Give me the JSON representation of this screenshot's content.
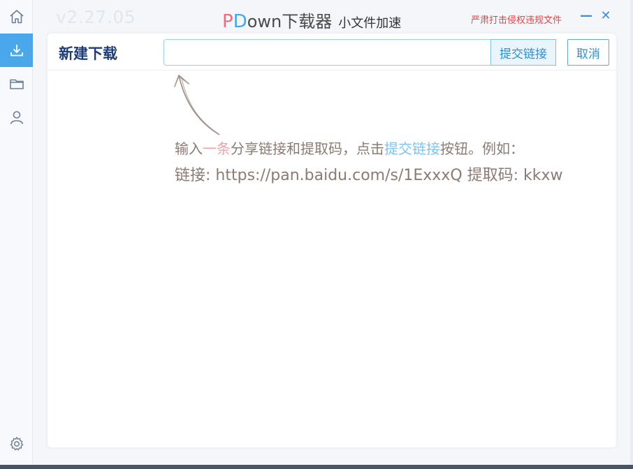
{
  "header": {
    "version": "v2.27.05",
    "brand": {
      "p": "P",
      "d": "D",
      "rest": "own下载器",
      "subtitle": "小文件加速"
    },
    "warning": "严肃打击侵权违规文件",
    "minimize_label": "—",
    "close_label": "✕"
  },
  "sidebar": {
    "items": [
      {
        "icon": "home-icon",
        "active": false
      },
      {
        "icon": "download-icon",
        "active": true
      },
      {
        "icon": "folder-icon",
        "active": false
      },
      {
        "icon": "user-icon",
        "active": false
      },
      {
        "icon": "gear-icon",
        "active": false
      }
    ]
  },
  "panel": {
    "title": "新建下载",
    "input_value": "",
    "input_placeholder": "",
    "submit_label": "提交链接",
    "cancel_label": "取消"
  },
  "hint": {
    "line1_pre": "输入",
    "line1_pink": "一条",
    "line1_mid": "分享链接和提取码，点击",
    "line1_blue": "提交链接",
    "line1_post": "按钮。例如：",
    "line2": "链接: https://pan.baidu.com/s/1ExxxQ 提取码: kkxw"
  },
  "colors": {
    "accent": "#4aa8ea",
    "brand_p": "#f06b7d",
    "brand_d": "#3fa9f0",
    "warning": "#e04545",
    "title": "#1f3d75",
    "hint_text": "#8b7b72",
    "hint_pink": "#f0a0a8",
    "hint_blue": "#7fc2ef"
  }
}
